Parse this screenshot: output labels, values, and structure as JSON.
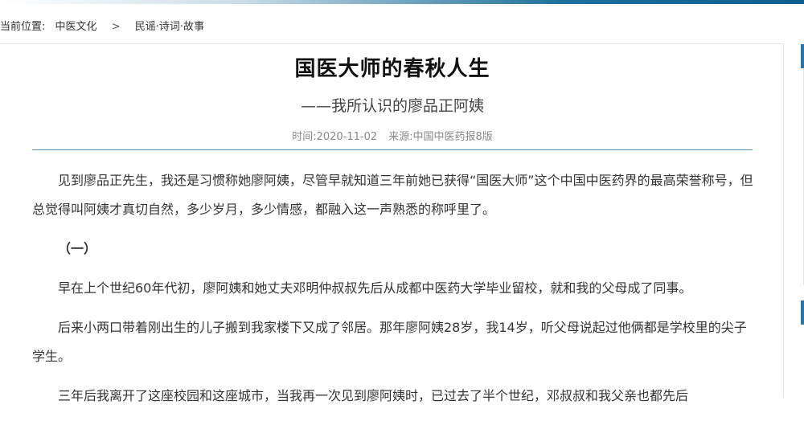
{
  "breadcrumb": {
    "prefix": "当前位置:",
    "items": [
      "中医文化",
      "民谣·诗词·故事"
    ],
    "separator": ">"
  },
  "article": {
    "title": "国医大师的春秋人生",
    "subtitle": "——我所认识的廖品正阿姨",
    "meta": {
      "time_label": "时间:",
      "time": "2020-11-02",
      "source_label": "来源:",
      "source": "中国中医药报8版"
    },
    "paragraphs": [
      "见到廖品正先生，我还是习惯称她廖阿姨，尽管早就知道三年前她已获得“国医大师”这个中国中医药界的最高荣誉称号，但总觉得叫阿姨才真切自然，多少岁月，多少情感，都融入这一声熟悉的称呼里了。",
      "（一）",
      "早在上个世纪60年代初，廖阿姨和她丈夫邓明仲叔叔先后从成都中医药大学毕业留校，就和我的父母成了同事。",
      "后来小两口带着刚出生的儿子搬到我家楼下又成了邻居。那年廖阿姨28岁，我14岁，听父母说起过他俩都是学校里的尖子学生。",
      "三年后我离开了这座校园和这座城市，当我再一次见到廖阿姨时，已过去了半个世纪，邓叔叔和我父亲也都先后"
    ]
  },
  "colors": {
    "accent": "#1e78b4",
    "rule": "#5b8fbd"
  }
}
